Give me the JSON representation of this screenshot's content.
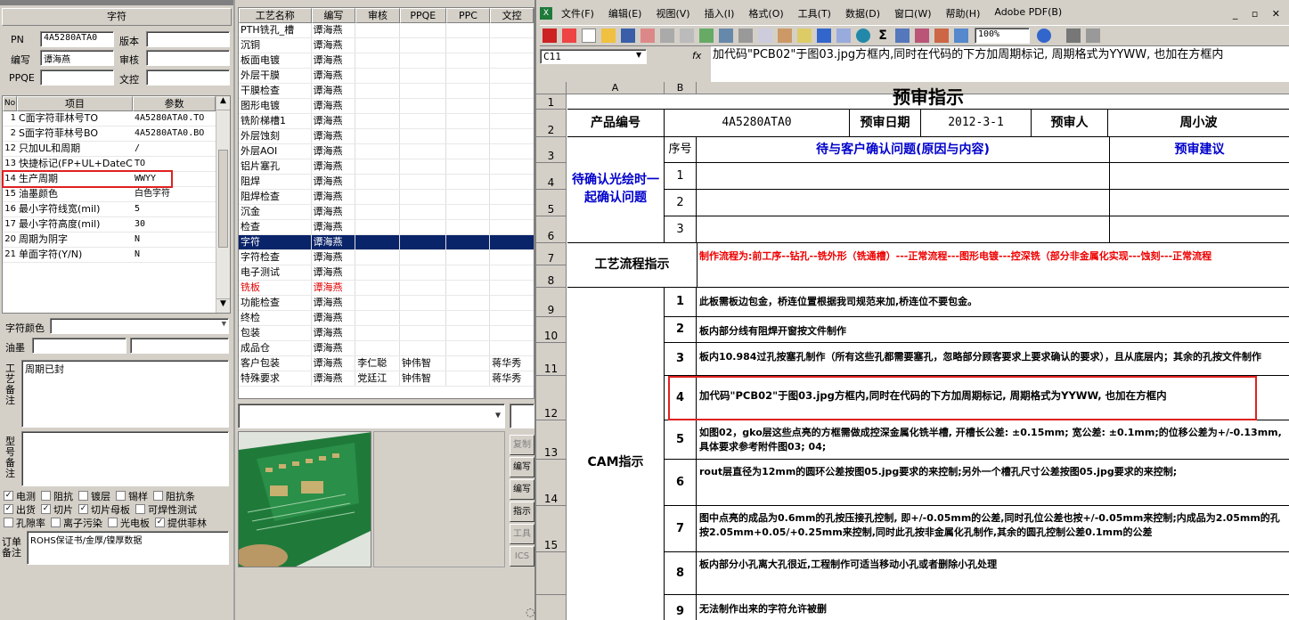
{
  "left": {
    "header": "字符",
    "pn_label": "PN",
    "pn_value": "4A5280ATA0",
    "version_label": "版本",
    "version_value": "",
    "author_label": "编写",
    "author_value": "谭海燕",
    "review_label": "审核",
    "review_value": "",
    "ppqe_label": "PPQE",
    "ppqe_value": "",
    "doc_label": "文控",
    "doc_value": "",
    "grid_cols": [
      "No",
      "项目",
      "参数"
    ],
    "grid_rows": [
      {
        "no": "1",
        "item": "C面字符菲林号TO",
        "param": "4A5280ATA0.TO"
      },
      {
        "no": "2",
        "item": "S面字符菲林号BO",
        "param": "4A5280ATA0.BO"
      },
      {
        "no": "12",
        "item": "只加UL和周期",
        "param": "/"
      },
      {
        "no": "13",
        "item": "快捷标记(FP+UL+DateCo",
        "param": "TO"
      },
      {
        "no": "14",
        "item": "生产周期",
        "param": "WWYY"
      },
      {
        "no": "15",
        "item": "油墨颜色",
        "param": "白色字符"
      },
      {
        "no": "16",
        "item": "最小字符线宽(mil)",
        "param": "5"
      },
      {
        "no": "17",
        "item": "最小字符高度(mil)",
        "param": "30"
      },
      {
        "no": "20",
        "item": "周期为阴字",
        "param": "N"
      },
      {
        "no": "21",
        "item": "单面字符(Y/N)",
        "param": "N"
      }
    ],
    "char_color_label": "字符颜色",
    "ink_label": "油墨",
    "process_note_label": "工艺备注",
    "process_note_value": "周期已封",
    "model_note_label": "型号备注",
    "model_note_value": "",
    "checks": [
      {
        "label": "电测",
        "checked": true
      },
      {
        "label": "阻抗",
        "checked": false
      },
      {
        "label": "镀层",
        "checked": false
      },
      {
        "label": "锡样",
        "checked": false
      },
      {
        "label": "阻抗条",
        "checked": false
      },
      {
        "label": "出货",
        "checked": true
      },
      {
        "label": "切片",
        "checked": true
      },
      {
        "label": "切片母板",
        "checked": true
      },
      {
        "label": "可焊性测试",
        "checked": false
      },
      {
        "label": "孔隙率",
        "checked": false
      },
      {
        "label": "离子污染",
        "checked": false
      },
      {
        "label": "光电板",
        "checked": false
      },
      {
        "label": "提供菲林",
        "checked": true
      }
    ],
    "order_note_label": "订单备注",
    "order_note_value": "ROHS保证书/金厚/镍厚数据"
  },
  "middle": {
    "cols": [
      "工艺名称",
      "编写",
      "审核",
      "PPQE",
      "PPC",
      "文控"
    ],
    "rows": [
      {
        "name": "PTH铣孔_槽",
        "author": "谭海燕",
        "review": "",
        "ppqe": "",
        "ppc": "",
        "doc": ""
      },
      {
        "name": "沉铜",
        "author": "谭海燕",
        "review": "",
        "ppqe": "",
        "ppc": "",
        "doc": ""
      },
      {
        "name": "板面电镀",
        "author": "谭海燕",
        "review": "",
        "ppqe": "",
        "ppc": "",
        "doc": ""
      },
      {
        "name": "外层干膜",
        "author": "谭海燕",
        "review": "",
        "ppqe": "",
        "ppc": "",
        "doc": ""
      },
      {
        "name": "干膜检查",
        "author": "谭海燕",
        "review": "",
        "ppqe": "",
        "ppc": "",
        "doc": ""
      },
      {
        "name": "图形电镀",
        "author": "谭海燕",
        "review": "",
        "ppqe": "",
        "ppc": "",
        "doc": ""
      },
      {
        "name": "铣阶梯槽1",
        "author": "谭海燕",
        "review": "",
        "ppqe": "",
        "ppc": "",
        "doc": ""
      },
      {
        "name": "外层蚀刻",
        "author": "谭海燕",
        "review": "",
        "ppqe": "",
        "ppc": "",
        "doc": ""
      },
      {
        "name": "外层AOI",
        "author": "谭海燕",
        "review": "",
        "ppqe": "",
        "ppc": "",
        "doc": ""
      },
      {
        "name": "铝片塞孔",
        "author": "谭海燕",
        "review": "",
        "ppqe": "",
        "ppc": "",
        "doc": ""
      },
      {
        "name": "阻焊",
        "author": "谭海燕",
        "review": "",
        "ppqe": "",
        "ppc": "",
        "doc": ""
      },
      {
        "name": "阻焊检查",
        "author": "谭海燕",
        "review": "",
        "ppqe": "",
        "ppc": "",
        "doc": ""
      },
      {
        "name": "沉金",
        "author": "谭海燕",
        "review": "",
        "ppqe": "",
        "ppc": "",
        "doc": ""
      },
      {
        "name": "检查",
        "author": "谭海燕",
        "review": "",
        "ppqe": "",
        "ppc": "",
        "doc": ""
      },
      {
        "name": "字符",
        "author": "谭海燕",
        "review": "",
        "ppqe": "",
        "ppc": "",
        "doc": "",
        "selected": true
      },
      {
        "name": "字符检查",
        "author": "谭海燕",
        "review": "",
        "ppqe": "",
        "ppc": "",
        "doc": ""
      },
      {
        "name": "电子测试",
        "author": "谭海燕",
        "review": "",
        "ppqe": "",
        "ppc": "",
        "doc": ""
      },
      {
        "name": "铣板",
        "author": "谭海燕",
        "review": "",
        "ppqe": "",
        "ppc": "",
        "doc": "",
        "red": true
      },
      {
        "name": "功能检查",
        "author": "谭海燕",
        "review": "",
        "ppqe": "",
        "ppc": "",
        "doc": ""
      },
      {
        "name": "终检",
        "author": "谭海燕",
        "review": "",
        "ppqe": "",
        "ppc": "",
        "doc": ""
      },
      {
        "name": "包装",
        "author": "谭海燕",
        "review": "",
        "ppqe": "",
        "ppc": "",
        "doc": ""
      },
      {
        "name": "成品仓",
        "author": "谭海燕",
        "review": "",
        "ppqe": "",
        "ppc": "",
        "doc": ""
      },
      {
        "name": "客户包装",
        "author": "谭海燕",
        "review": "李仁聪",
        "ppqe": "钟伟智",
        "ppc": "",
        "doc": "蒋华秀"
      },
      {
        "name": "特殊要求",
        "author": "谭海燕",
        "review": "党廷江",
        "ppqe": "钟伟智",
        "ppc": "",
        "doc": "蒋华秀"
      }
    ],
    "side_buttons": [
      "复制",
      "编写",
      "编写",
      "指示",
      "工具",
      "ICS"
    ]
  },
  "excel": {
    "menu": [
      "文件(F)",
      "编辑(E)",
      "视图(V)",
      "插入(I)",
      "格式(O)",
      "工具(T)",
      "数据(D)",
      "窗口(W)",
      "帮助(H)",
      "Adobe PDF(B)"
    ],
    "zoom": "100%",
    "name_box": "C11",
    "fx": "fx",
    "formula": "加代码\"PCB02\"于图03.jpg方框内,同时在代码的下方加周期标记, 周期格式为YYWW, 也加在方框内",
    "col_headers": [
      "A",
      "B"
    ],
    "title": "预审指示",
    "product_label": "产品编号",
    "product_value": "4A5280ATA0",
    "date_label": "预审日期",
    "date_value": "2012-3-1",
    "reviewer_label": "预审人",
    "reviewer_value": "周小波",
    "confirm_label": "待确认光绘时一起确认问题",
    "seq_label": "序号",
    "issue_header": "待与客户确认问题(原因与内容)",
    "suggest_header": "预审建议",
    "issue_nums": [
      "1",
      "2",
      "3"
    ],
    "flow_label": "工艺流程指示",
    "flow_text": "制作流程为:前工序--钻孔--铣外形（铣通槽）---正常流程---图形电镀---控深铣（部分非金属化实现---蚀刻---正常流程",
    "cam_label": "CAM指示",
    "cam_items": [
      {
        "n": "1",
        "text": "此板需板边包金，桥连位置根据我司规范来加,桥连位不要包金。"
      },
      {
        "n": "2",
        "text": "板内部分线有阻焊开窗按文件制作"
      },
      {
        "n": "3",
        "text": "板内10.984过孔按塞孔制作（所有这些孔都需要塞孔，忽略部分顾客要求上要求确认的要求），且从底层内；其余的孔按文件制作"
      },
      {
        "n": "4",
        "text": "加代码\"PCB02\"于图03.jpg方框内,同时在代码的下方加周期标记, 周期格式为YYWW, 也加在方框内"
      },
      {
        "n": "5",
        "text": "如图02，gko层这些点亮的方框需做成控深金属化铣半槽, 开槽长公差: ±0.15mm; 宽公差: ±0.1mm;的位移公差为+/-0.13mm,具体要求参考附件图03; 04;"
      },
      {
        "n": "6",
        "text": "rout层直径为12mm的圆环公差按图05.jpg要求的来控制;另外一个槽孔尺寸公差按图05.jpg要求的来控制;"
      },
      {
        "n": "7",
        "text": "图中点亮的成品为0.6mm的孔按压接孔控制, 即+/-0.05mm的公差,同时孔位公差也按+/-0.05mm来控制;内成品为2.05mm的孔按2.05mm+0.05/+0.25mm来控制,同时此孔按非金属化孔制作,其余的圆孔控制公差0.1mm的公差"
      },
      {
        "n": "8",
        "text": "板内部分小孔离大孔很近,工程制作可适当移动小孔或者删除小孔处理"
      },
      {
        "n": "9",
        "text": "无法制作出来的字符允许被删"
      }
    ],
    "row_numbers": [
      "1",
      "2",
      "3",
      "4",
      "5",
      "6",
      "7",
      "8",
      "9",
      "10",
      "11",
      "12",
      "13",
      "14",
      "15"
    ]
  }
}
